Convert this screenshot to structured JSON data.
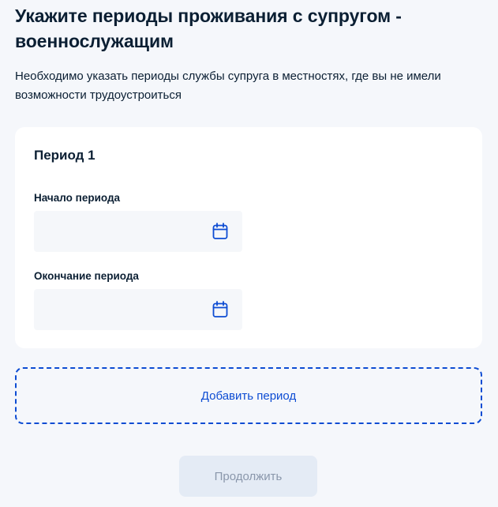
{
  "header": {
    "title": "Укажите периоды проживания с супругом - военнослужащим",
    "subtitle": "Необходимо указать периоды службы супруга в местностях, где вы не имели возможности трудоустроиться"
  },
  "period_card": {
    "title": "Период 1",
    "start": {
      "label": "Начало периода",
      "value": "",
      "icon": "calendar-icon"
    },
    "end": {
      "label": "Окончание периода",
      "value": "",
      "icon": "calendar-icon"
    }
  },
  "actions": {
    "add_period": "Добавить период",
    "continue": "Продолжить",
    "continue_enabled": false
  },
  "colors": {
    "accent": "#0d4cd3",
    "background": "#f5f7fb",
    "input_bg": "#f5f7fa",
    "disabled_button_bg": "#e4ebf5",
    "disabled_button_text": "#8a97ab"
  }
}
